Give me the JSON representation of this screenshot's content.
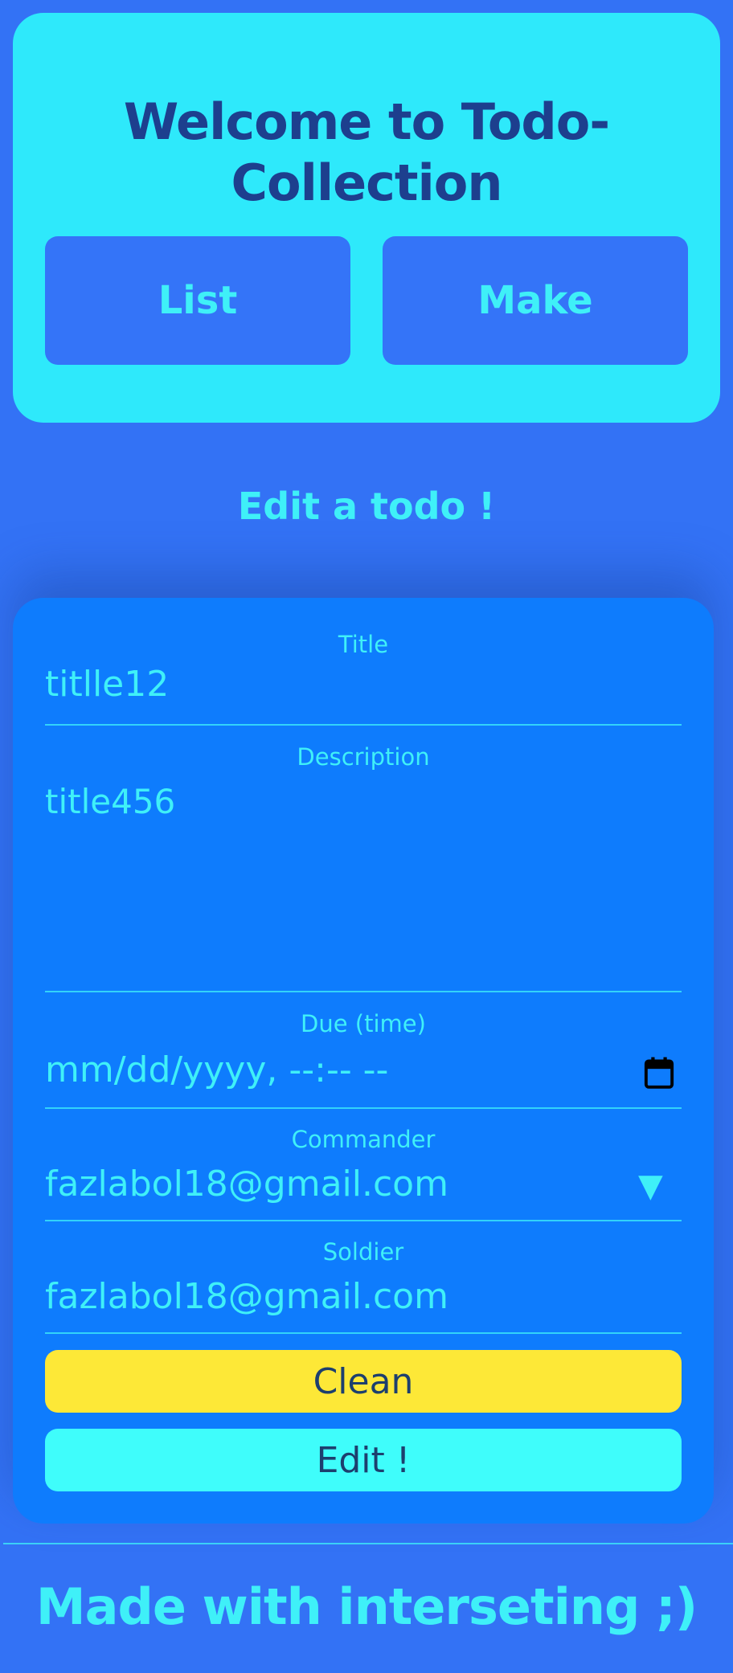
{
  "header": {
    "title": "Welcome to Todo- Collection",
    "buttons": {
      "list": "List",
      "make": "Make"
    }
  },
  "section_title": "Edit a todo !",
  "form": {
    "title": {
      "label": "Title",
      "value": "titlle12"
    },
    "description": {
      "label": "Description",
      "value": "title456"
    },
    "due": {
      "label": "Due (time)",
      "placeholder": "mm/dd/yyyy, --:-- --",
      "icon": "calendar-icon"
    },
    "commander": {
      "label": "Commander",
      "value": "fazlabol18@gmail.com",
      "icon": "caret-down-icon"
    },
    "soldier": {
      "label": "Soldier",
      "value": "fazlabol18@gmail.com"
    },
    "clean_label": "Clean",
    "edit_label": "Edit !"
  },
  "footer": {
    "text": "Made with interseting ;)"
  },
  "colors": {
    "background": "#3372f5",
    "header_bg": "#2ee9fb",
    "card_bg": "#0e7cfd",
    "accent_text": "#3ff0f8",
    "title_text": "#1d3f8e",
    "clean_button": "#fde837",
    "edit_button": "#3ffdfb"
  }
}
